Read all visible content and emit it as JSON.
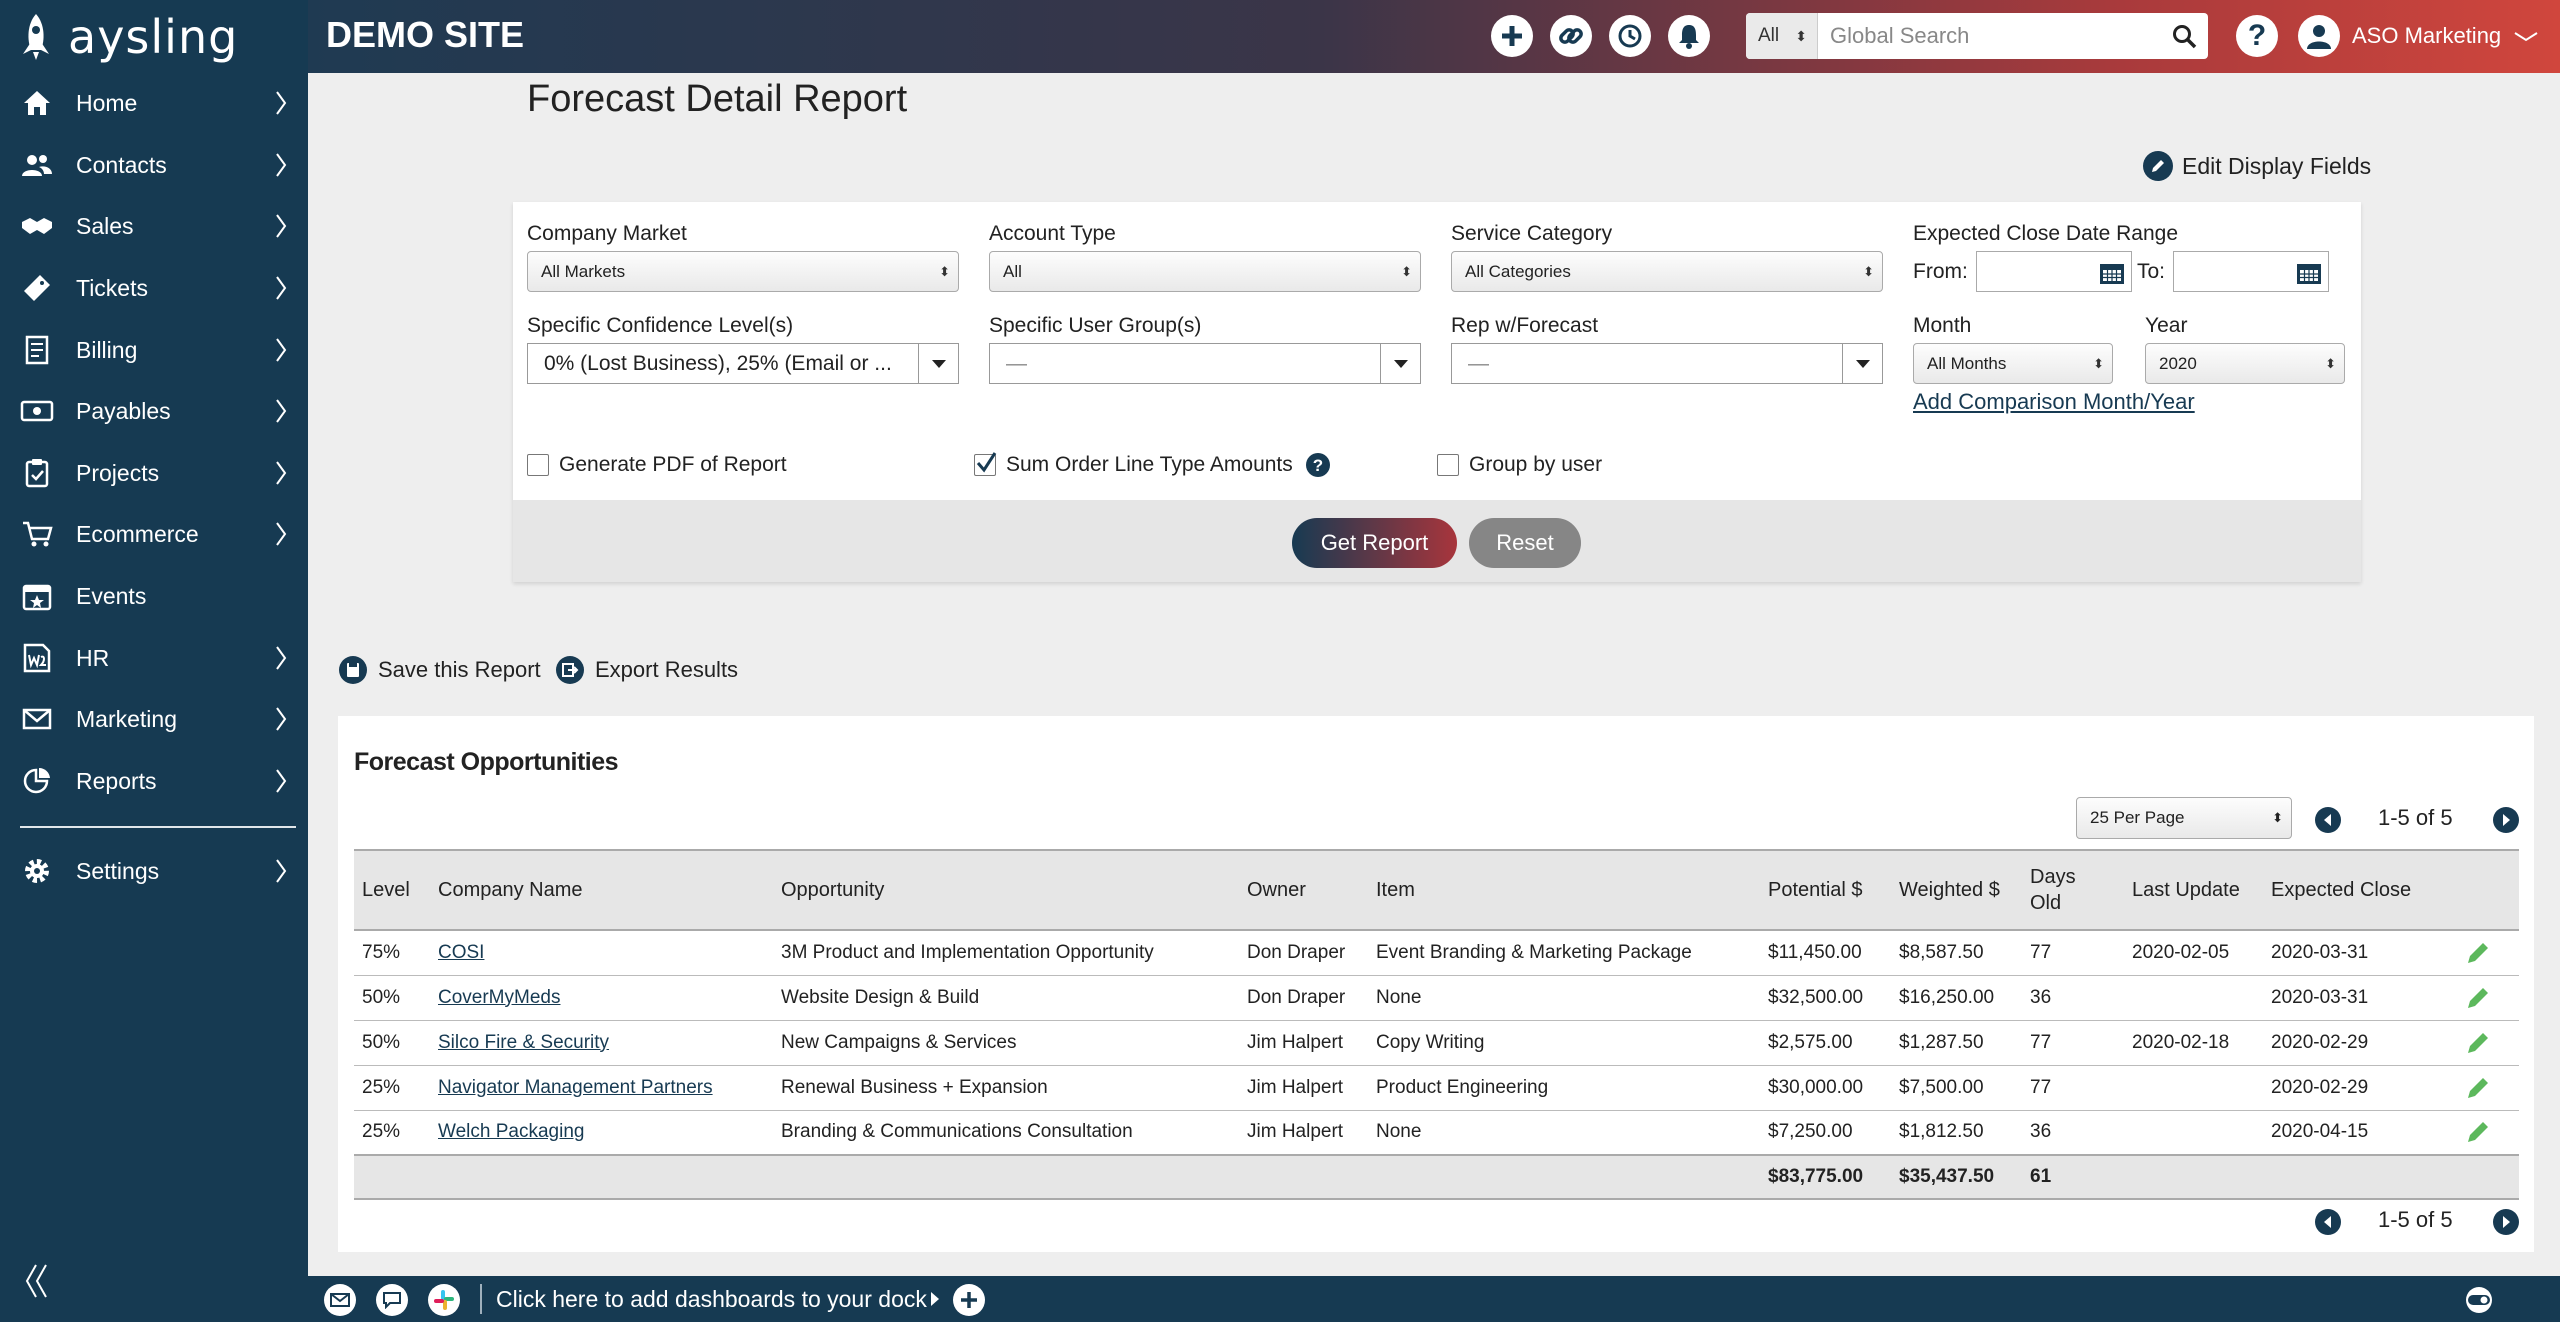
{
  "brand": {
    "logo_text": "aysling"
  },
  "sidebar": {
    "items": [
      {
        "label": "Home",
        "icon": "home-icon"
      },
      {
        "label": "Contacts",
        "icon": "contacts-icon"
      },
      {
        "label": "Sales",
        "icon": "handshake-icon"
      },
      {
        "label": "Tickets",
        "icon": "ticket-icon"
      },
      {
        "label": "Billing",
        "icon": "billing-icon"
      },
      {
        "label": "Payables",
        "icon": "payables-icon"
      },
      {
        "label": "Projects",
        "icon": "clipboard-icon"
      },
      {
        "label": "Ecommerce",
        "icon": "cart-icon"
      },
      {
        "label": "Events",
        "icon": "calendar-icon"
      },
      {
        "label": "HR",
        "icon": "w2-icon"
      },
      {
        "label": "Marketing",
        "icon": "envelope-icon"
      },
      {
        "label": "Reports",
        "icon": "reports-icon"
      }
    ],
    "settings_label": "Settings"
  },
  "header": {
    "site_title": "DEMO SITE",
    "search_scope": "All",
    "search_placeholder": "Global Search",
    "help_label": "?",
    "user_name": "ASO Marketing"
  },
  "page": {
    "title": "Forecast Detail Report",
    "edit_fields_label": "Edit Display Fields"
  },
  "filters": {
    "company_market": {
      "label": "Company Market",
      "value": "All Markets"
    },
    "account_type": {
      "label": "Account Type",
      "value": "All"
    },
    "service_category": {
      "label": "Service Category",
      "value": "All Categories"
    },
    "close_range": {
      "label": "Expected Close Date Range",
      "from_label": "From:",
      "to_label": "To:"
    },
    "confidence": {
      "label": "Specific Confidence Level(s)",
      "value": "0% (Lost Business), 25% (Email or ..."
    },
    "user_group": {
      "label": "Specific User Group(s)",
      "value": "—"
    },
    "rep_forecast": {
      "label": "Rep w/Forecast",
      "value": "—"
    },
    "month": {
      "label": "Month",
      "value": "All Months"
    },
    "year": {
      "label": "Year",
      "value": "2020"
    },
    "add_comparison": "Add Comparison Month/Year",
    "generate_pdf": {
      "label": "Generate PDF of Report",
      "checked": false
    },
    "sum_order_line": {
      "label": "Sum Order Line Type Amounts",
      "checked": true
    },
    "group_by_user": {
      "label": "Group by user",
      "checked": false
    },
    "get_report_label": "Get Report",
    "reset_label": "Reset"
  },
  "actions": {
    "save_label": "Save this Report",
    "export_label": "Export Results"
  },
  "results": {
    "title": "Forecast Opportunities",
    "per_page": "25 Per Page",
    "page_info": "1-5 of 5",
    "columns": {
      "level": "Level",
      "company": "Company Name",
      "opportunity": "Opportunity",
      "owner": "Owner",
      "item": "Item",
      "potential": "Potential $",
      "weighted": "Weighted $",
      "days_old": "Days Old",
      "last_update": "Last Update",
      "expected_close": "Expected Close"
    },
    "rows": [
      {
        "level": "75%",
        "company": "COSI",
        "opportunity": "3M Product and Implementation Opportunity",
        "owner": "Don Draper",
        "item": "Event Branding & Marketing Package",
        "potential": "$11,450.00",
        "weighted": "$8,587.50",
        "days_old": "77",
        "last_update": "2020-02-05",
        "expected_close": "2020-03-31"
      },
      {
        "level": "50%",
        "company": "CoverMyMeds",
        "opportunity": "Website Design & Build",
        "owner": "Don Draper",
        "item": "None",
        "potential": "$32,500.00",
        "weighted": "$16,250.00",
        "days_old": "36",
        "last_update": "",
        "expected_close": "2020-03-31"
      },
      {
        "level": "50%",
        "company": "Silco Fire & Security",
        "opportunity": "New Campaigns & Services",
        "owner": "Jim Halpert",
        "item": "Copy Writing",
        "potential": "$2,575.00",
        "weighted": "$1,287.50",
        "days_old": "77",
        "last_update": "2020-02-18",
        "expected_close": "2020-02-29"
      },
      {
        "level": "25%",
        "company": "Navigator Management Partners",
        "opportunity": "Renewal Business + Expansion",
        "owner": "Jim Halpert",
        "item": "Product Engineering",
        "potential": "$30,000.00",
        "weighted": "$7,500.00",
        "days_old": "77",
        "last_update": "",
        "expected_close": "2020-02-29"
      },
      {
        "level": "25%",
        "company": "Welch Packaging",
        "opportunity": "Branding & Communications Consultation",
        "owner": "Jim Halpert",
        "item": "None",
        "potential": "$7,250.00",
        "weighted": "$1,812.50",
        "days_old": "36",
        "last_update": "",
        "expected_close": "2020-04-15"
      }
    ],
    "totals": {
      "potential": "$83,775.00",
      "weighted": "$35,437.50",
      "days_old": "61"
    }
  },
  "dock": {
    "hint": "Click here to add dashboards to your dock"
  },
  "colors": {
    "sidebar": "#163a52",
    "header_start": "#1f3a52",
    "header_end": "#d0463d",
    "edit_pencil": "#4caf50"
  }
}
